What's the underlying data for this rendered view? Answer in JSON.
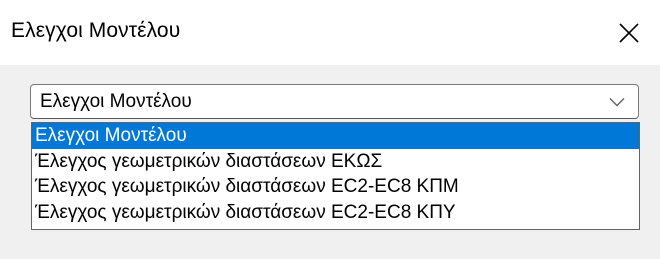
{
  "window": {
    "title": "Ελεγχοι Μοντέλου",
    "close_icon": "close-icon"
  },
  "combo": {
    "value": "Ελεγχοι Μοντέλου",
    "arrow_icon": "chevron-down-icon"
  },
  "dropdown": {
    "items": [
      {
        "label": "Ελεγχοι Μοντέλου",
        "selected": true
      },
      {
        "label": "Έλεγχος γεωμετρικών διαστάσεων ΕΚΩΣ",
        "selected": false
      },
      {
        "label": "Έλεγχος γεωμετρικών διαστάσεων EC2-EC8 ΚΠΜ",
        "selected": false
      },
      {
        "label": "Έλεγχος γεωμετρικών διαστάσεων EC2-EC8 ΚΠΥ",
        "selected": false
      }
    ]
  },
  "colors": {
    "selection": "#0078d7",
    "title_bar": "#ffffff",
    "dialog_background": "#f0f0f0"
  }
}
